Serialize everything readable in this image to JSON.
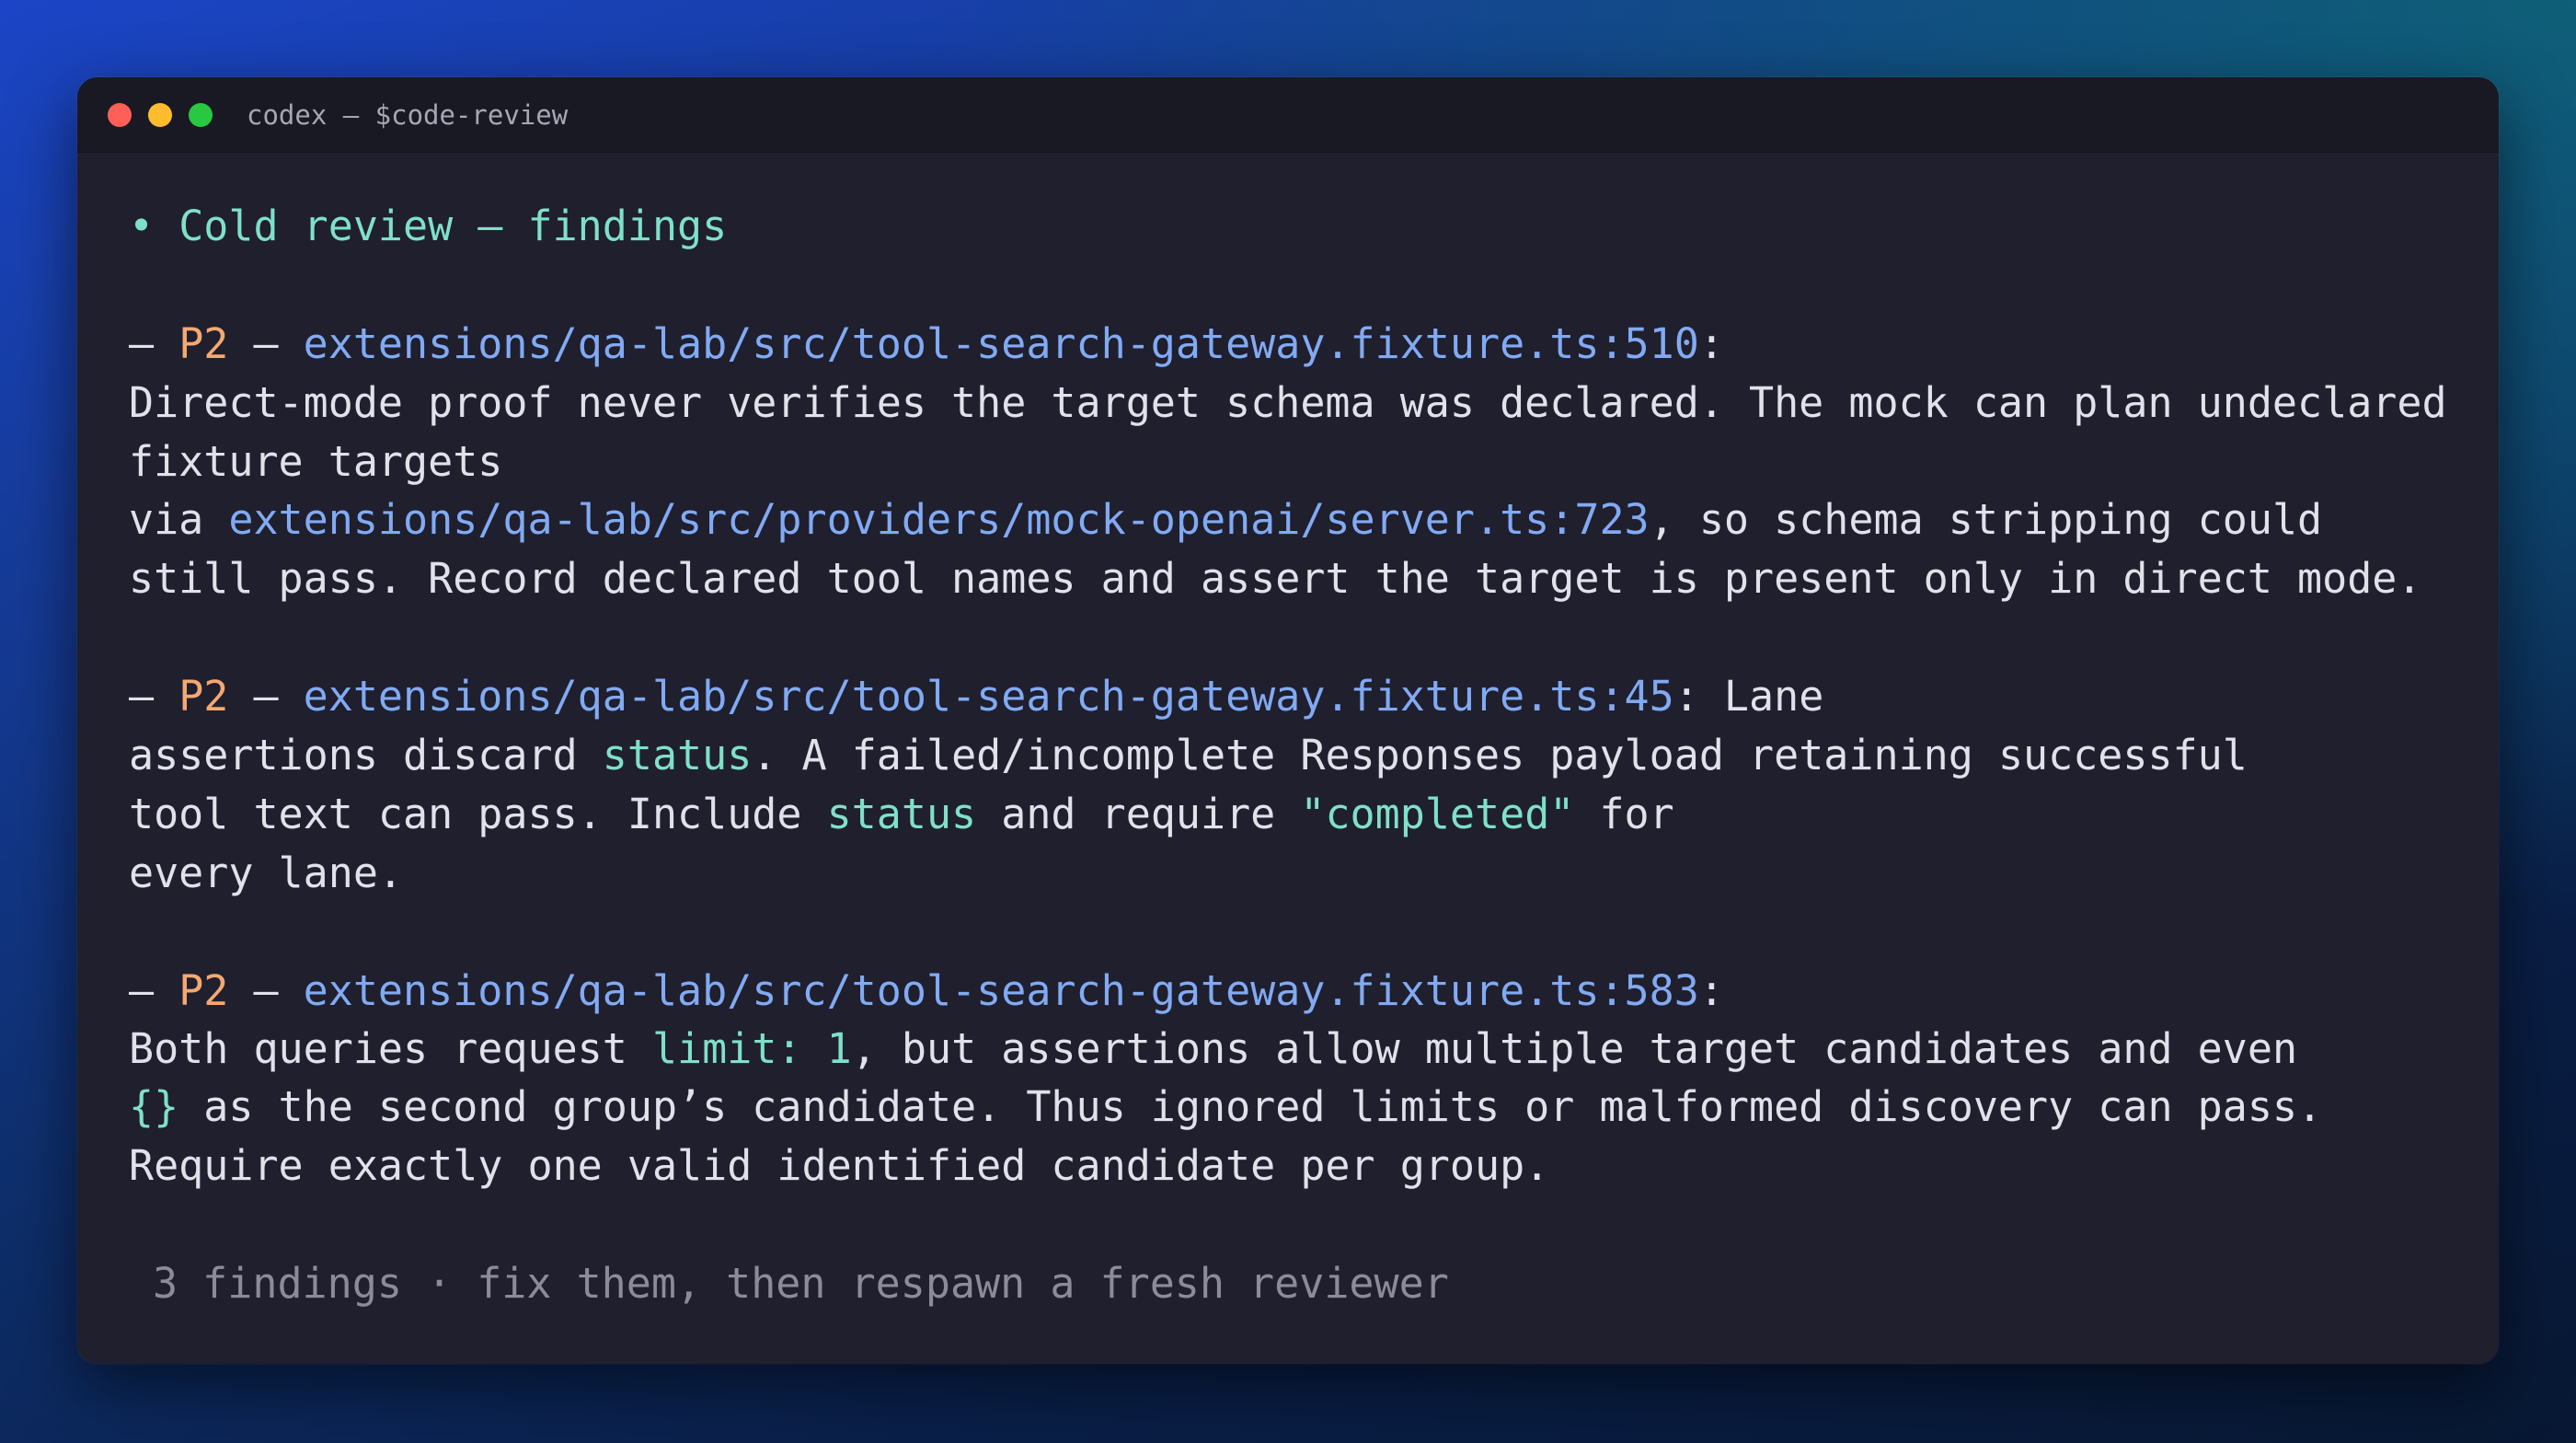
{
  "window": {
    "title": "codex — $code-review",
    "traffic_lights": {
      "close_color": "#ff5f57",
      "minimize_color": "#febc2e",
      "zoom_color": "#28c840"
    }
  },
  "heading": {
    "bullet": "•",
    "text": "Cold review — findings"
  },
  "findings": [
    {
      "dash": "–",
      "priority": "P2",
      "sep": "—",
      "location": "extensions/qa-lab/src/tool-search-gateway.fixture.ts:510",
      "colon": ":",
      "line1": "Direct-mode proof never verifies the target schema was declared. The mock can plan undeclared",
      "line2": "fixture targets",
      "via": "via ",
      "via_path": "extensions/qa-lab/src/providers/mock-openai/server.ts:723",
      "line3_rest": ", so schema stripping could",
      "line4": "still pass. Record declared tool names and assert the target is present only in direct mode."
    },
    {
      "dash": "–",
      "priority": "P2",
      "sep": "—",
      "location": "extensions/qa-lab/src/tool-search-gateway.fixture.ts:45",
      "colon_rest": ": Lane",
      "l2a": "assertions discard ",
      "l2_code": "status",
      "l2b": ". A failed/incomplete Responses payload retaining successful",
      "l3a": "tool text can pass. Include ",
      "l3_code1": "status",
      "l3b": " and require ",
      "l3_code2": "\"completed\"",
      "l3c": " for",
      "l4": "every lane."
    },
    {
      "dash": "–",
      "priority": "P2",
      "sep": "—",
      "location": "extensions/qa-lab/src/tool-search-gateway.fixture.ts:583",
      "colon": ":",
      "l2a": "Both queries request ",
      "l2_code": "limit: 1",
      "l2b": ", but assertions allow multiple target candidates and even",
      "l3_code": "{}",
      "l3b": " as the second group’s candidate. Thus ignored limits or malformed discovery can pass.",
      "l4": "Require exactly one valid identified candidate per group."
    }
  ],
  "footer": "3 findings · fix them, then respawn a fresh reviewer"
}
